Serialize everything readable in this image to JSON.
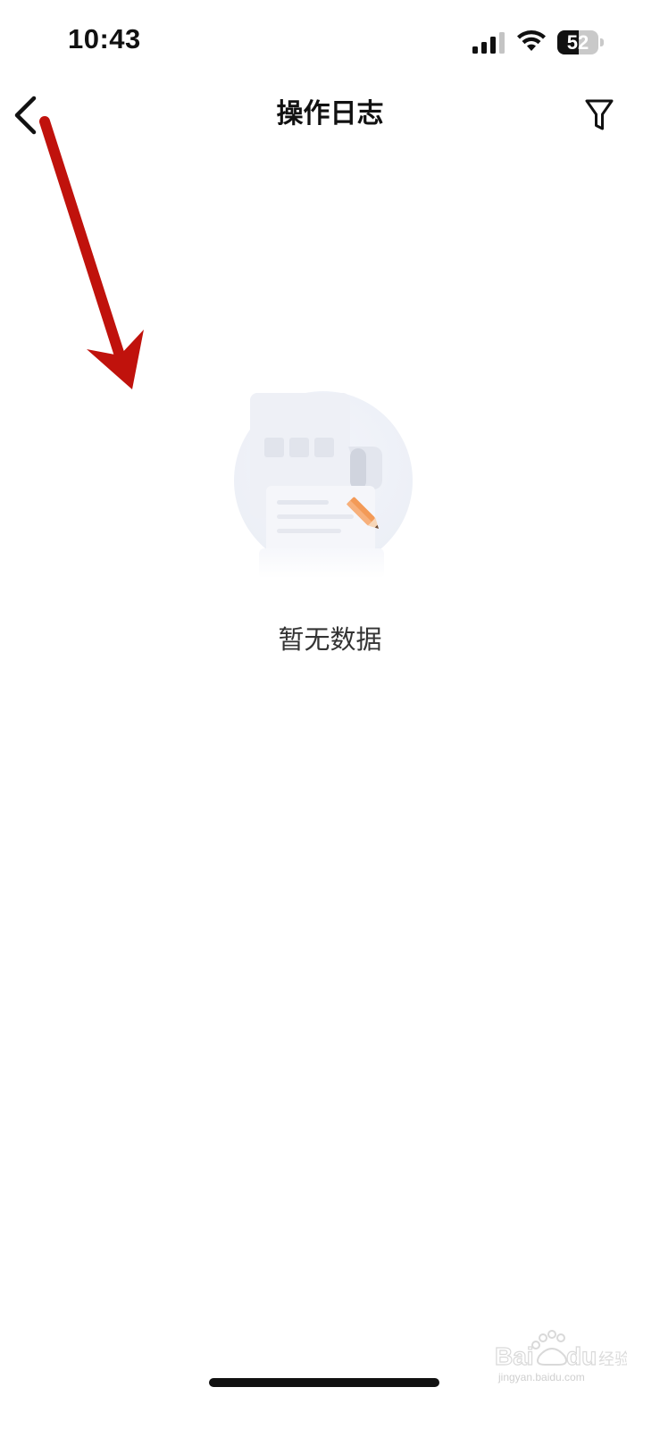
{
  "status_bar": {
    "time": "10:43",
    "battery_level": "52",
    "battery_fraction": 0.52,
    "icons": [
      "signal-icon",
      "wifi-icon",
      "battery-icon"
    ]
  },
  "nav": {
    "title": "操作日志",
    "back_icon": "chevron-left-icon",
    "filter_icon": "filter-icon"
  },
  "empty_state": {
    "message": "暂无数据",
    "illustration": "empty-document-pencil-illustration"
  },
  "annotation": {
    "arrow_color": "#c0120c"
  },
  "watermark": {
    "brand": "Baidu 经验",
    "url": "jingyan.baidu.com"
  },
  "colors": {
    "background": "#ffffff",
    "text_primary": "#111111",
    "text_secondary": "#333333",
    "accent_pencil": "#f39a57"
  }
}
